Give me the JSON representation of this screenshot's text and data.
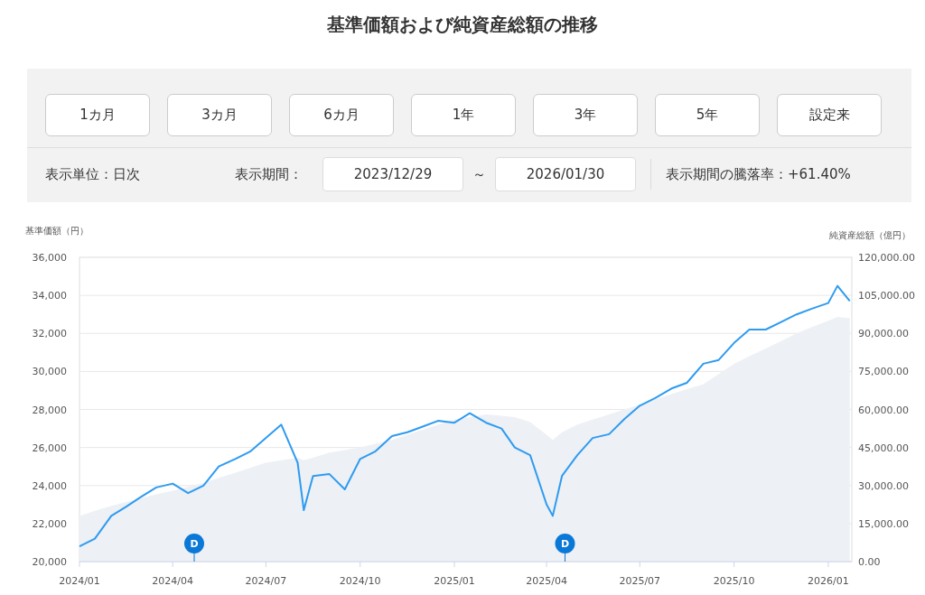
{
  "title": "基準価額および純資産総額の推移",
  "periods": [
    {
      "label": "1カ月",
      "selected": false
    },
    {
      "label": "3カ月",
      "selected": false
    },
    {
      "label": "6カ月",
      "selected": false
    },
    {
      "label": "1年",
      "selected": false
    },
    {
      "label": "3年",
      "selected": false
    },
    {
      "label": "5年",
      "selected": false
    },
    {
      "label": "設定来",
      "selected": false
    }
  ],
  "unit_label": "表示単位：日次",
  "period_label": "表示期間：",
  "start_date": "2023/12/29",
  "range_sep": "～",
  "end_date": "2026/01/30",
  "change_label": "表示期間の騰落率：+61.40%",
  "chart": {
    "chart_data": {
      "type": "line",
      "ylabel": "基準価額（円）",
      "ylim": [
        20000,
        36000
      ],
      "y2lim": [
        0,
        120000
      ],
      "y2label": "純資産総額（億円）",
      "grid": true,
      "y2ticks": [
        {
          "value": 0,
          "label": "0.00"
        },
        {
          "value": 15000,
          "label": "15,000.00"
        },
        {
          "value": 30000,
          "label": "30,000.00"
        },
        {
          "value": 45000,
          "label": "45,000.00"
        },
        {
          "value": 60000,
          "label": "60,000.00"
        },
        {
          "value": 75000,
          "label": "75,000.00"
        },
        {
          "value": 90000,
          "label": "90,000.00"
        },
        {
          "value": 105000,
          "label": "105,000.00"
        },
        {
          "value": 120000,
          "label": "120,000.00"
        }
      ],
      "xlim": [
        "2024-01-01",
        "2026-01-24"
      ],
      "yticks": [
        {
          "value": 20000,
          "label": "20,000"
        },
        {
          "value": 22000,
          "label": "22,000"
        },
        {
          "value": 24000,
          "label": "24,000"
        },
        {
          "value": 26000,
          "label": "26,000"
        },
        {
          "value": 28000,
          "label": "28,000"
        },
        {
          "value": 30000,
          "label": "30,000"
        },
        {
          "value": 32000,
          "label": "32,000"
        },
        {
          "value": 34000,
          "label": "34,000"
        },
        {
          "value": 36000,
          "label": "36,000"
        }
      ],
      "xticks": [
        {
          "value": "2024-01-01",
          "label": "2024/01"
        },
        {
          "value": "2024-04-01",
          "label": "2024/04"
        },
        {
          "value": "2024-07-01",
          "label": "2024/07"
        },
        {
          "value": "2024-10-01",
          "label": "2024/10"
        },
        {
          "value": "2025-01-01",
          "label": "2025/01"
        },
        {
          "value": "2025-04-01",
          "label": "2025/04"
        },
        {
          "value": "2025-07-01",
          "label": "2025/07"
        },
        {
          "value": "2025-10-01",
          "label": "2025/10"
        },
        {
          "value": "2026-01-01",
          "label": "2026/01"
        }
      ],
      "x": [
        "2024-01-01",
        "2024-01-16",
        "2024-02-01",
        "2024-02-16",
        "2024-03-01",
        "2024-03-16",
        "2024-04-01",
        "2024-04-16",
        "2024-05-01",
        "2024-05-16",
        "2024-06-01",
        "2024-06-16",
        "2024-07-01",
        "2024-07-16",
        "2024-08-01",
        "2024-08-07",
        "2024-08-16",
        "2024-09-01",
        "2024-09-16",
        "2024-10-01",
        "2024-10-16",
        "2024-11-01",
        "2024-11-16",
        "2024-12-01",
        "2024-12-16",
        "2025-01-01",
        "2025-01-16",
        "2025-02-01",
        "2025-02-16",
        "2025-03-01",
        "2025-03-16",
        "2025-04-01",
        "2025-04-07",
        "2025-04-16",
        "2025-05-01",
        "2025-05-16",
        "2025-06-01",
        "2025-06-16",
        "2025-07-01",
        "2025-07-16",
        "2025-08-01",
        "2025-08-16",
        "2025-09-01",
        "2025-09-16",
        "2025-10-01",
        "2025-10-16",
        "2025-11-01",
        "2025-11-16",
        "2025-12-01",
        "2025-12-16",
        "2026-01-01",
        "2026-01-10",
        "2026-01-22"
      ],
      "series": [
        {
          "type": "area",
          "axis": "y2",
          "color": "#edf0f5",
          "values": [
            18000,
            20000,
            22000,
            23500,
            25000,
            26500,
            28000,
            29500,
            31000,
            33000,
            35000,
            37000,
            39000,
            40000,
            41000,
            40000,
            41000,
            43000,
            44000,
            45000,
            46500,
            48000,
            50000,
            52000,
            54000,
            56000,
            57000,
            58000,
            57500,
            57000,
            55000,
            50000,
            48000,
            51000,
            54000,
            56000,
            58000,
            60000,
            62000,
            64000,
            66000,
            68000,
            70000,
            74000,
            78000,
            81000,
            84000,
            87000,
            90000,
            92500,
            95000,
            96500,
            96000
          ]
        },
        {
          "color": "#2e9bf0",
          "values": [
            20800,
            21200,
            22400,
            22900,
            23400,
            23900,
            24100,
            23600,
            24000,
            25000,
            25400,
            25800,
            26500,
            27200,
            25200,
            22700,
            24500,
            24600,
            23800,
            25400,
            25800,
            26600,
            26800,
            27100,
            27400,
            27300,
            27800,
            27300,
            27000,
            26000,
            25600,
            23000,
            22400,
            24500,
            25600,
            26500,
            26700,
            27500,
            28200,
            28600,
            29100,
            29400,
            30400,
            30600,
            31500,
            32200,
            32200,
            32600,
            33000,
            33300,
            33600,
            34500,
            33700
          ]
        }
      ],
      "annotations": [
        {
          "x": "2024-04-22",
          "text": "D"
        },
        {
          "x": "2025-04-19",
          "text": "D"
        }
      ]
    }
  }
}
